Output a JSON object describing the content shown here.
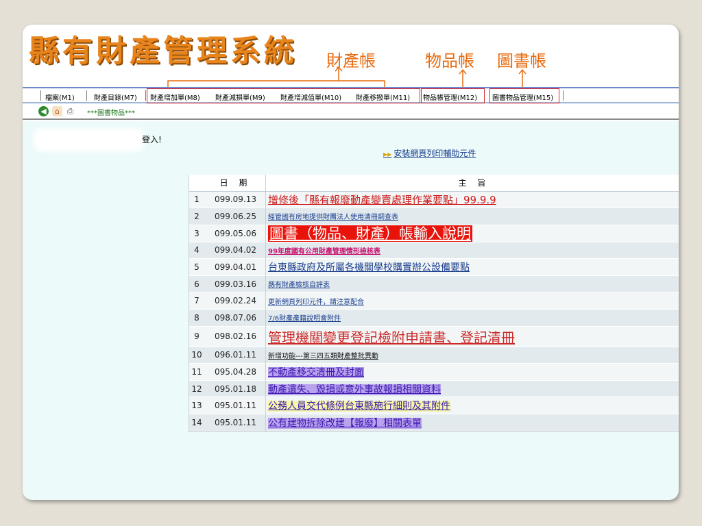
{
  "title": "縣有財產管理系統",
  "annotations": {
    "property": "財產帳",
    "goods": "物品帳",
    "books": "圖書帳"
  },
  "menu": [
    {
      "label": "檔案(M1)"
    },
    {
      "label": "財產目錄(M7)"
    },
    {
      "label": "財產增加單(M8)"
    },
    {
      "label": "財產減損單(M9)"
    },
    {
      "label": "財產增減值單(M10)"
    },
    {
      "label": "財產移撥單(M11)"
    },
    {
      "label": "物品帳管理(M12)"
    },
    {
      "label": "圖書物品管理(M15)"
    }
  ],
  "toolbar": {
    "breadcrumb": "***圖書物品***",
    "icons": [
      "back-arrow-icon",
      "home-icon",
      "print-icon"
    ]
  },
  "login_suffix": "登入!",
  "install_link": "安裝網頁列印輔助元件",
  "table": {
    "headers": [
      "",
      "日  期",
      "主  旨"
    ],
    "rows": [
      {
        "num": "1",
        "date": "099.09.13",
        "subject": "增修後「縣有報廢動產變賣處理作業要點」99.9.9"
      },
      {
        "num": "2",
        "date": "099.06.25",
        "subject": "經管國有房地提供財團法人使用清冊調查表"
      },
      {
        "num": "3",
        "date": "099.05.06",
        "subject": "圖書（物品、財產）帳輸入說明"
      },
      {
        "num": "4",
        "date": "099.04.02",
        "subject": "99年度國有公用財產管理情形檢核表"
      },
      {
        "num": "5",
        "date": "099.04.01",
        "subject": "台東縣政府及所屬各機關學校購置辦公設備要點"
      },
      {
        "num": "6",
        "date": "099.03.16",
        "subject": "縣有財產檢核自評表"
      },
      {
        "num": "7",
        "date": "099.02.24",
        "subject": "更新網頁列印元件，請注意配合"
      },
      {
        "num": "8",
        "date": "098.07.06",
        "subject": "7/6財產產籍說明會附件"
      },
      {
        "num": "9",
        "date": "098.02.16",
        "subject": "管理機關變更登記檢附申請書、登記清冊"
      },
      {
        "num": "10",
        "date": "096.01.11",
        "subject": "新增功能---第三四五類財產整批異動"
      },
      {
        "num": "11",
        "date": "095.04.28",
        "subject": "不動產移交清冊及封面"
      },
      {
        "num": "12",
        "date": "095.01.18",
        "subject": "動產遺失、毀損或意外事故報損相關資料"
      },
      {
        "num": "13",
        "date": "095.01.11",
        "subject": "公務人員交代條例台東縣施行細則及其附件"
      },
      {
        "num": "14",
        "date": "095.01.11",
        "subject": "公有建物拆除改建【報廢】相關表單"
      }
    ]
  },
  "colors": {
    "title": "#e8841c",
    "annotation": "#e86c10",
    "highlight_box": "#d8262c",
    "content_bg": "#ecfafa"
  }
}
